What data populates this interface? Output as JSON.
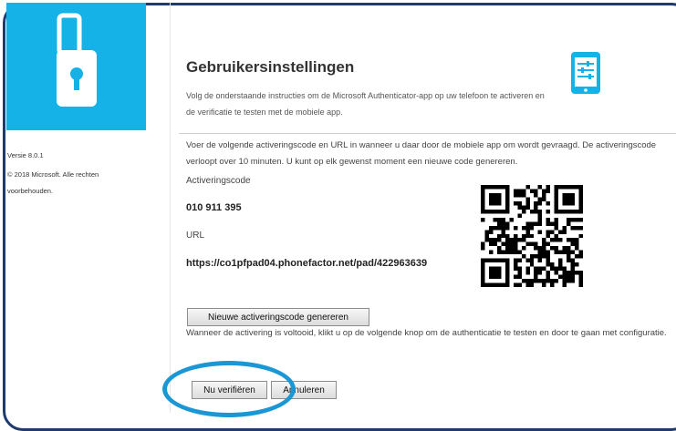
{
  "sidebar": {
    "version": "Versie 8.0.1",
    "copyright": "© 2018 Microsoft. Alle rechten voorbehouden."
  },
  "header": {
    "title": "Gebruikersinstellingen",
    "intro": "Volg de onderstaande instructies om de Microsoft Authenticator-app op uw telefoon te activeren en de verificatie te testen met de mobiele app."
  },
  "activation": {
    "instructions": "Voer de volgende activeringscode en URL in wanneer u daar door de mobiele app om wordt gevraagd. De activeringscode verloopt over 10 minuten. U kunt op elk gewenst moment een nieuwe code genereren.",
    "code_label": "Activeringscode",
    "code_value": "010 911 395",
    "url_label": "URL",
    "url_value": "https://co1pfpad04.phonefactor.net/pad/422963639",
    "new_code_button": "Nieuwe activeringscode genereren"
  },
  "completion": {
    "text": "Wanneer de activering is voltooid, klikt u op de volgende knop om de authenticatie te testen en door te gaan met configuratie.",
    "verify_button": "Nu verifiëren",
    "cancel_button": "Annuleren"
  },
  "colors": {
    "brand_blue": "#15b2e8",
    "highlight": "#1a97d4",
    "frame": "#1f3b6e"
  },
  "icons": {
    "logo": "phone-lock-icon",
    "settings": "phone-settings-icon",
    "qr": "qr-code"
  }
}
